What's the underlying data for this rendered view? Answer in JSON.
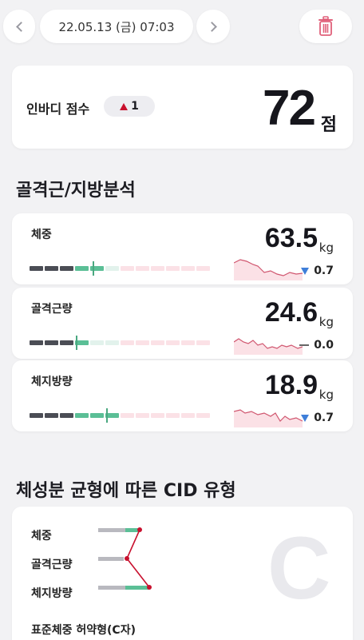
{
  "header": {
    "date": "22.05.13 (금) 07:03",
    "prev_icon": "chevron-left-icon",
    "next_icon": "chevron-right-icon",
    "delete_icon": "trash-icon"
  },
  "score": {
    "label": "인바디 점수",
    "change": "1",
    "change_direction": "up",
    "value": "72",
    "unit": "점"
  },
  "section_titles": {
    "muscle_fat": "골격근/지방분석",
    "cid": "체성분 균형에 따른 CID 유형"
  },
  "metrics": [
    {
      "label": "체중",
      "value": "63.5",
      "unit": "kg",
      "change": "0.7",
      "change_direction": "down",
      "gauge": 0.34
    },
    {
      "label": "골격근량",
      "value": "24.6",
      "unit": "kg",
      "change": "0.0",
      "change_direction": "none",
      "gauge": 0.25
    },
    {
      "label": "체지방량",
      "value": "18.9",
      "unit": "kg",
      "change": "0.7",
      "change_direction": "down",
      "gauge": 0.41
    }
  ],
  "cid": {
    "rows": [
      "체중",
      "골격근량",
      "체지방량"
    ],
    "letter": "C",
    "type_label": "표준체중 허약형(C자)"
  },
  "colors": {
    "accent_red": "#c8102e",
    "down_blue": "#3f7fd9",
    "gauge_green": "#5bbf96",
    "gauge_dark": "#4b4d55",
    "gauge_pink": "#fbe1e6"
  }
}
